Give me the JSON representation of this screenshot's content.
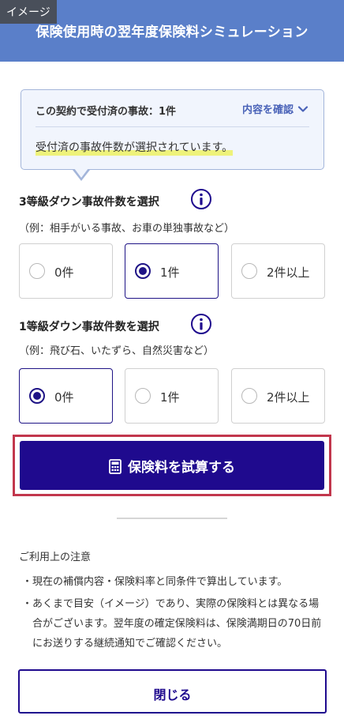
{
  "badge": "イメージ",
  "header": {
    "title": "保険使用時の翌年度保険料シミュレーション"
  },
  "info_box": {
    "count_text": "この契約で受付済の事故：1件",
    "detail_link": "内容を確認",
    "message": "受付済の事故件数が選択されています。"
  },
  "section3": {
    "title": "3等級ダウン事故件数を選択",
    "subtitle": "（例：相手がいる事故、お車の単独事故など）",
    "options": [
      "0件",
      "1件",
      "2件以上"
    ],
    "selected": "1件"
  },
  "section1": {
    "title": "1等級ダウン事故件数を選択",
    "subtitle": "（例：飛び石、いたずら、自然災害など）",
    "options": [
      "0件",
      "1件",
      "2件以上"
    ],
    "selected": "0件"
  },
  "calc_button": {
    "label": "保険料を試算する"
  },
  "notes": {
    "title": "ご利用上の注意",
    "items": [
      "現在の補償内容・保険料率と同条件で算出しています。",
      "あくまで目安（イメージ）であり、実際の保険料とは異なる場合がございます。翌年度の確定保険料は、保険満期日の70日前にお送りする継続通知でご確認ください。"
    ]
  },
  "close_button": {
    "label": "閉じる"
  },
  "colors": {
    "header_bg": "#5a7fc9",
    "primary": "#1f0a8e",
    "highlight_frame": "#c2374d",
    "link": "#4a63b8",
    "marker": "#eef27a"
  },
  "icons": [
    "chevron-down-icon",
    "info-icon",
    "calculator-icon"
  ]
}
